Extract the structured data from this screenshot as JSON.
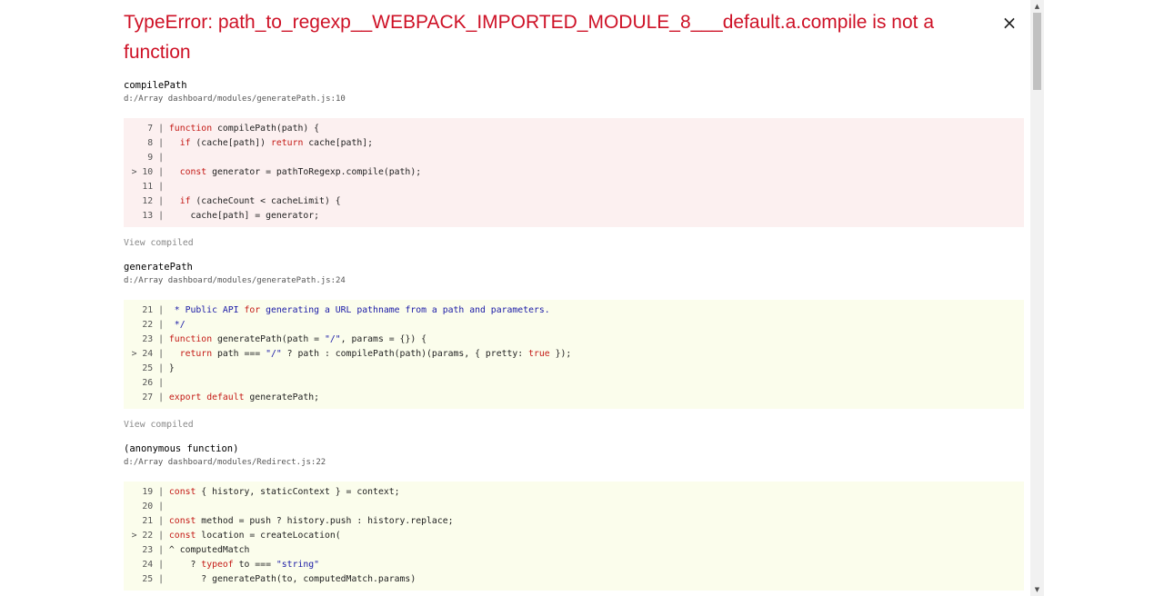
{
  "error": {
    "title": "TypeError: path_to_regexp__WEBPACK_IMPORTED_MODULE_8___default.a.compile is not a function",
    "close_label": "×"
  },
  "frames": [
    {
      "function": "compilePath",
      "location": "d:/Array dashboard/modules/generatePath.js:10",
      "is_error": true,
      "lines": [
        {
          "gutter": "  7 |",
          "code": " function compilePath(path) {"
        },
        {
          "gutter": "  8 |",
          "code": "   if (cache[path]) return cache[path];"
        },
        {
          "gutter": "  9 |",
          "code": ""
        },
        {
          "gutter": "> 10 |",
          "code": "   const generator = pathToRegexp.compile(path);"
        },
        {
          "gutter": " 11 |",
          "code": ""
        },
        {
          "gutter": " 12 |",
          "code": "   if (cacheCount < cacheLimit) {"
        },
        {
          "gutter": " 13 |",
          "code": "     cache[path] = generator;"
        }
      ],
      "view_compiled": "View compiled"
    },
    {
      "function": "generatePath",
      "location": "d:/Array dashboard/modules/generatePath.js:24",
      "is_error": false,
      "lines": [
        {
          "gutter": " 21 |",
          "code": "  * Public API for generating a URL pathname from a path and parameters."
        },
        {
          "gutter": " 22 |",
          "code": "  */"
        },
        {
          "gutter": " 23 |",
          "code": " function generatePath(path = \"/\", params = {}) {"
        },
        {
          "gutter": "> 24 |",
          "code": "   return path === \"/\" ? path : compilePath(path)(params, { pretty: true });"
        },
        {
          "gutter": " 25 |",
          "code": " }"
        },
        {
          "gutter": " 26 |",
          "code": ""
        },
        {
          "gutter": " 27 |",
          "code": " export default generatePath;"
        }
      ],
      "view_compiled": "View compiled"
    },
    {
      "function": "(anonymous function)",
      "location": "d:/Array dashboard/modules/Redirect.js:22",
      "is_error": false,
      "lines": [
        {
          "gutter": " 19 |",
          "code": " const { history, staticContext } = context;"
        },
        {
          "gutter": " 20 |",
          "code": ""
        },
        {
          "gutter": " 21 |",
          "code": " const method = push ? history.push : history.replace;"
        },
        {
          "gutter": "> 22 |",
          "code": " const location = createLocation("
        },
        {
          "gutter": " 23 |",
          "code": " ^ computedMatch"
        },
        {
          "gutter": " 24 |",
          "code": "     ? typeof to === \"string\""
        },
        {
          "gutter": " 25 |",
          "code": "       ? generatePath(to, computedMatch.params)"
        }
      ]
    }
  ],
  "scrollbar": {
    "up_icon": "▲",
    "down_icon": "▼"
  }
}
